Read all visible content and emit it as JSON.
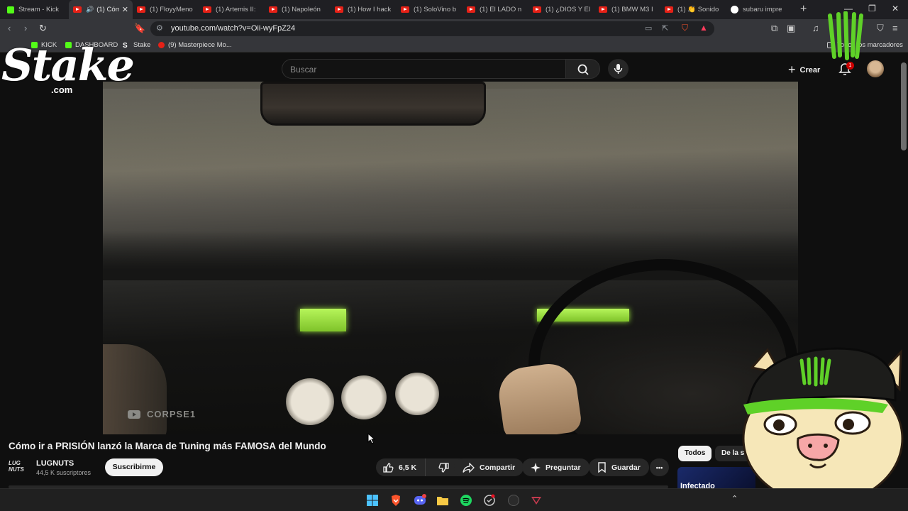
{
  "browser": {
    "tabs": [
      {
        "label": "Stream - Kick",
        "favicon": "kick-icon",
        "active": false
      },
      {
        "label": "(1) Cóm",
        "favicon": "youtube-icon",
        "active": true
      },
      {
        "label": "(1) FloyyMeno",
        "favicon": "youtube-icon",
        "active": false
      },
      {
        "label": "(1) Artemis II:",
        "favicon": "youtube-icon",
        "active": false
      },
      {
        "label": "(1) Napoleón",
        "favicon": "youtube-icon",
        "active": false
      },
      {
        "label": "(1) How I hack",
        "favicon": "youtube-icon",
        "active": false
      },
      {
        "label": "(1) SoloVino b",
        "favicon": "youtube-icon",
        "active": false
      },
      {
        "label": "(1) El LADO n",
        "favicon": "youtube-icon",
        "active": false
      },
      {
        "label": "(1) ¿DIOS Y El",
        "favicon": "youtube-icon",
        "active": false
      },
      {
        "label": "(1) BMW M3 I",
        "favicon": "youtube-icon",
        "active": false
      },
      {
        "label": "(1) 👏 Sonido",
        "favicon": "youtube-icon",
        "active": false
      },
      {
        "label": "subaru impre",
        "favicon": "google-icon",
        "active": false
      }
    ],
    "new_tab": "+",
    "url": "youtube.com/watch?v=Oii-wyFpZ24",
    "bookmarks": [
      {
        "label": "KICK",
        "icon": "kick-icon"
      },
      {
        "label": "DASHBOARD",
        "icon": "kick-icon"
      },
      {
        "label": "Stake",
        "icon": "stake-icon"
      },
      {
        "label": "(9) Masterpiece Mo...",
        "icon": "youtube-icon"
      }
    ],
    "all_bookmarks": "Todos los marcadores"
  },
  "youtube": {
    "search_placeholder": "Buscar",
    "create_label": "Crear",
    "notifications_count": "1",
    "video": {
      "watermark": "CORPSE1",
      "title": "Cómo ir a PRISIÓN lanzó la Marca de Tuning más FAMOSA del Mundo"
    },
    "channel": {
      "logo_text": "LUG NUTS",
      "name": "LUGNUTS",
      "subscribers": "44,5 K suscriptores",
      "subscribe_label": "Suscribirme"
    },
    "actions": {
      "likes": "6,5 K",
      "share": "Compartir",
      "ask": "Preguntar",
      "save": "Guardar",
      "more": "•••"
    },
    "filters": [
      "Todos",
      "De la serie"
    ],
    "thumb_peek_text": "Infectado"
  },
  "overlays": {
    "stake_word": "Stake",
    "stake_com": ".com"
  },
  "colors": {
    "youtube_red": "#e62117",
    "kick_green": "#53fc18",
    "monster_green": "#5fd128",
    "background": "#0f0f0f"
  }
}
